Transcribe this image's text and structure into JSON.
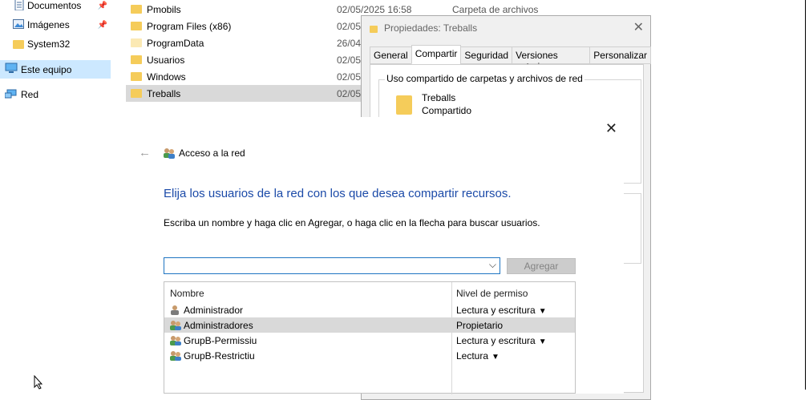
{
  "nav": {
    "items": [
      {
        "label": "Documentos",
        "icon": "documents-icon",
        "pinned": true
      },
      {
        "label": "Imágenes",
        "icon": "pictures-icon",
        "pinned": true
      },
      {
        "label": "System32",
        "icon": "folder-icon",
        "pinned": false
      },
      {
        "label": "Este equipo",
        "icon": "computer-icon",
        "selected": true
      },
      {
        "label": "Red",
        "icon": "network-icon"
      }
    ]
  },
  "files": [
    {
      "name": "Pmobils",
      "date": "02/05/2025 16:58",
      "type": "Carpeta de archivos"
    },
    {
      "name": "Program Files (x86)",
      "date": "02/05/",
      "type": ""
    },
    {
      "name": "ProgramData",
      "date": "26/04/",
      "type": ""
    },
    {
      "name": "Usuarios",
      "date": "02/05/",
      "type": ""
    },
    {
      "name": "Windows",
      "date": "02/05/",
      "type": ""
    },
    {
      "name": "Treballs",
      "date": "02/05/",
      "type": "",
      "selected": true
    }
  ],
  "properties": {
    "title": "Propiedades: Treballs",
    "tabs": [
      "General",
      "Compartir",
      "Seguridad",
      "Versiones anteriores",
      "Personalizar"
    ],
    "active_tab": "Compartir",
    "group_title": "Uso compartido de carpetas y archivos de red",
    "share_name": "Treballs",
    "share_status": "Compartido"
  },
  "wizard": {
    "title": "Acceso a la red",
    "heading": "Elija los usuarios de la red con los que desea compartir recursos.",
    "instruction": "Escriba un nombre y haga clic en Agregar, o haga clic en la flecha para buscar usuarios.",
    "combo_value": "",
    "add_label": "Agregar",
    "col_name": "Nombre",
    "col_perm": "Nivel de permiso",
    "users": [
      {
        "name": "Administrador",
        "perm": "Lectura y escritura",
        "dropdown": true,
        "icon": "user-icon"
      },
      {
        "name": "Administradores",
        "perm": "Propietario",
        "dropdown": false,
        "icon": "group-icon",
        "selected": true
      },
      {
        "name": "GrupB-Permissiu",
        "perm": "Lectura y escritura",
        "dropdown": true,
        "icon": "group-icon"
      },
      {
        "name": "GrupB-Restrictiu",
        "perm": "Lectura",
        "dropdown": true,
        "icon": "group-icon"
      }
    ]
  },
  "colors": {
    "accent": "#1b4aa8",
    "folder": "#f5cc5a",
    "selection": "#cce8ff"
  }
}
